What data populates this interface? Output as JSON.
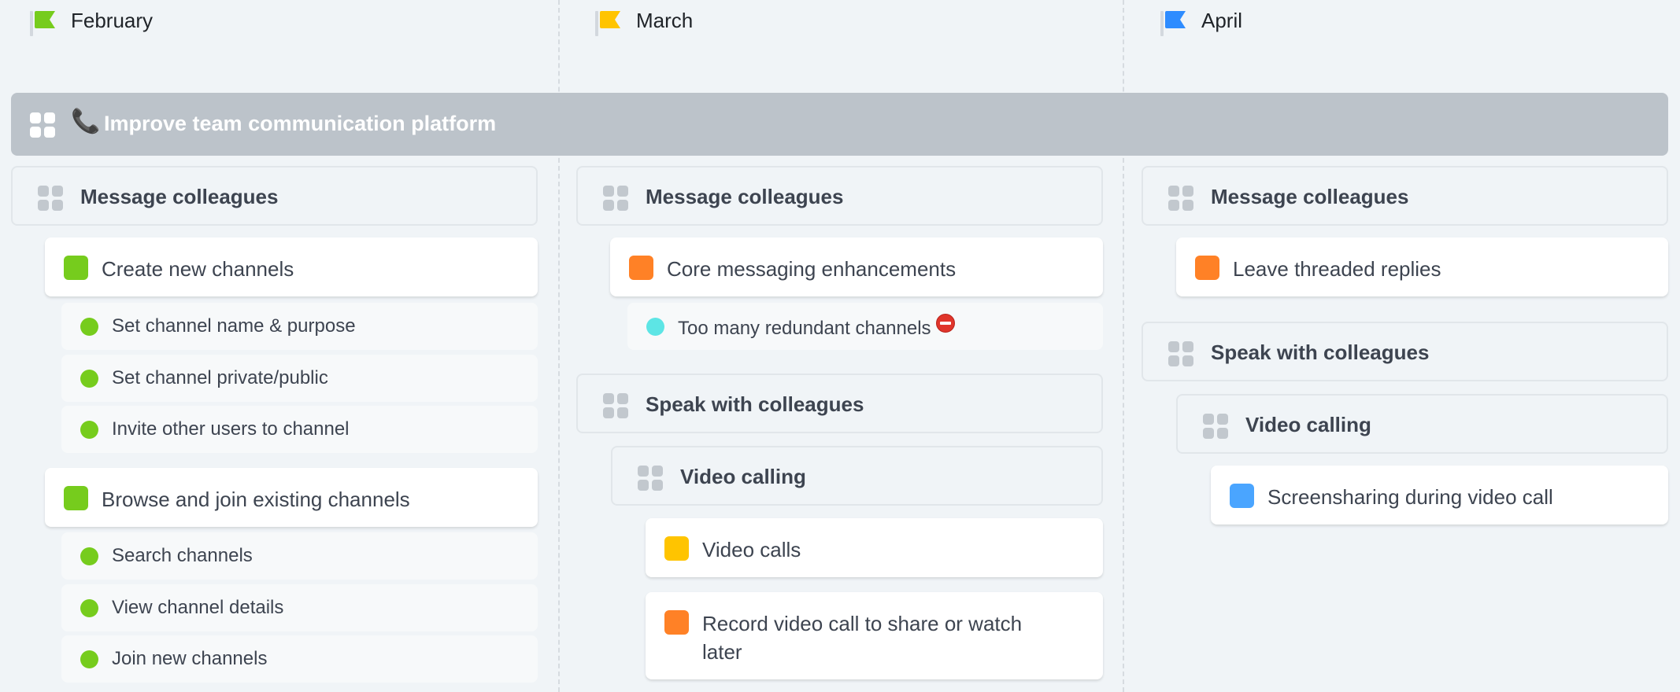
{
  "months": [
    {
      "label": "February",
      "flag_color": "#76cc1d",
      "icon": "flag-icon"
    },
    {
      "label": "March",
      "flag_color": "#ffc400",
      "icon": "flag-icon"
    },
    {
      "label": "April",
      "flag_color": "#2e8cff",
      "icon": "flag-icon"
    }
  ],
  "banner": {
    "icon": "grid-icon",
    "emoji": "📞",
    "title": "Improve team communication platform"
  },
  "colors": {
    "green": "#76cc1d",
    "orange": "#ff8126",
    "yellow": "#ffc400",
    "blue": "#4aa5ff",
    "cyan": "#5de5e5",
    "banner_bg": "#bcc3ca",
    "background": "#f0f4f7"
  },
  "february": {
    "group": {
      "title": "Message colleagues"
    },
    "cards": [
      {
        "title": "Create new channels",
        "status_color": "#76cc1d",
        "subitems": [
          {
            "title": "Set channel name & purpose",
            "dot_color": "#76cc1d"
          },
          {
            "title": "Set channel private/public",
            "dot_color": "#76cc1d"
          },
          {
            "title": "Invite other users to channel",
            "dot_color": "#76cc1d"
          }
        ]
      },
      {
        "title": "Browse and join existing channels",
        "status_color": "#76cc1d",
        "subitems": [
          {
            "title": "Search channels",
            "dot_color": "#76cc1d"
          },
          {
            "title": "View channel details",
            "dot_color": "#76cc1d"
          },
          {
            "title": "Join new channels",
            "dot_color": "#76cc1d"
          }
        ]
      }
    ]
  },
  "march": {
    "group1": {
      "title": "Message colleagues"
    },
    "card1": {
      "title": "Core messaging enhancements",
      "status_color": "#ff8126"
    },
    "sub1": {
      "title": "Too many redundant channels",
      "dot_color": "#5de5e5",
      "badge": "no-entry-icon"
    },
    "group2": {
      "title": "Speak with colleagues"
    },
    "group3": {
      "title": "Video calling"
    },
    "card2": {
      "title": "Video calls",
      "status_color": "#ffc400"
    },
    "card3": {
      "title": "Record video call to share or watch later",
      "status_color": "#ff8126"
    }
  },
  "april": {
    "group1": {
      "title": "Message colleagues"
    },
    "card1": {
      "title": "Leave threaded replies",
      "status_color": "#ff8126"
    },
    "group2": {
      "title": "Speak with colleagues"
    },
    "group3": {
      "title": "Video calling"
    },
    "card2": {
      "title": "Screensharing during video call",
      "status_color": "#4aa5ff"
    }
  }
}
